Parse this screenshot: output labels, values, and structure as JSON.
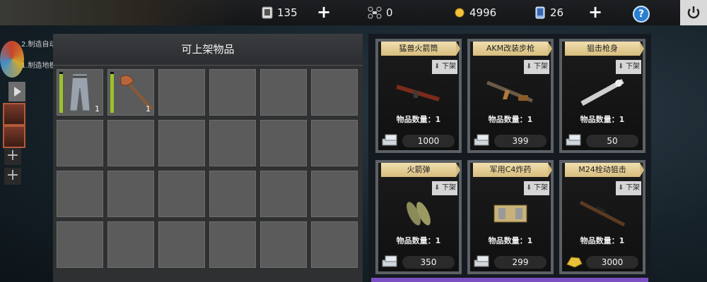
{
  "topbar": {
    "card_count": "135",
    "drone_count": "0",
    "gold": "4996",
    "phone_count": "26",
    "help_label": "?"
  },
  "left_strip": {
    "quest1": "2.制造自动",
    "quest2": "1.制造地板"
  },
  "inventory": {
    "title": "可上架物品",
    "items": [
      {
        "name": "pants",
        "count": "1",
        "durability": 0.95
      },
      {
        "name": "axe",
        "count": "1",
        "durability": 0.95
      }
    ]
  },
  "shop": {
    "qty_label_prefix": "物品数量：",
    "unlist_label": "下架",
    "listings": [
      {
        "name": "猛兽火箭筒",
        "qty": "1",
        "price": "1000",
        "currency_icon": "silver-bars-icon"
      },
      {
        "name": "AKM改装步枪",
        "qty": "1",
        "price": "399",
        "currency_icon": "silver-bars-icon"
      },
      {
        "name": "狙击枪身",
        "qty": "1",
        "price": "50",
        "currency_icon": "silver-bars-icon"
      },
      {
        "name": "火箭弹",
        "qty": "1",
        "price": "350",
        "currency_icon": "silver-bars-icon"
      },
      {
        "name": "军用C4炸药",
        "qty": "1",
        "price": "299",
        "currency_icon": "silver-bars-icon"
      },
      {
        "name": "M24栓动狙击",
        "qty": "1",
        "price": "3000",
        "currency_icon": "gold-nugget-icon"
      }
    ]
  },
  "colors": {
    "name_tag": "#e6d29b",
    "durability_bar": "#9cc22c",
    "help_button": "#2a7fd0",
    "bottom_accent": "#7a4fc2"
  }
}
